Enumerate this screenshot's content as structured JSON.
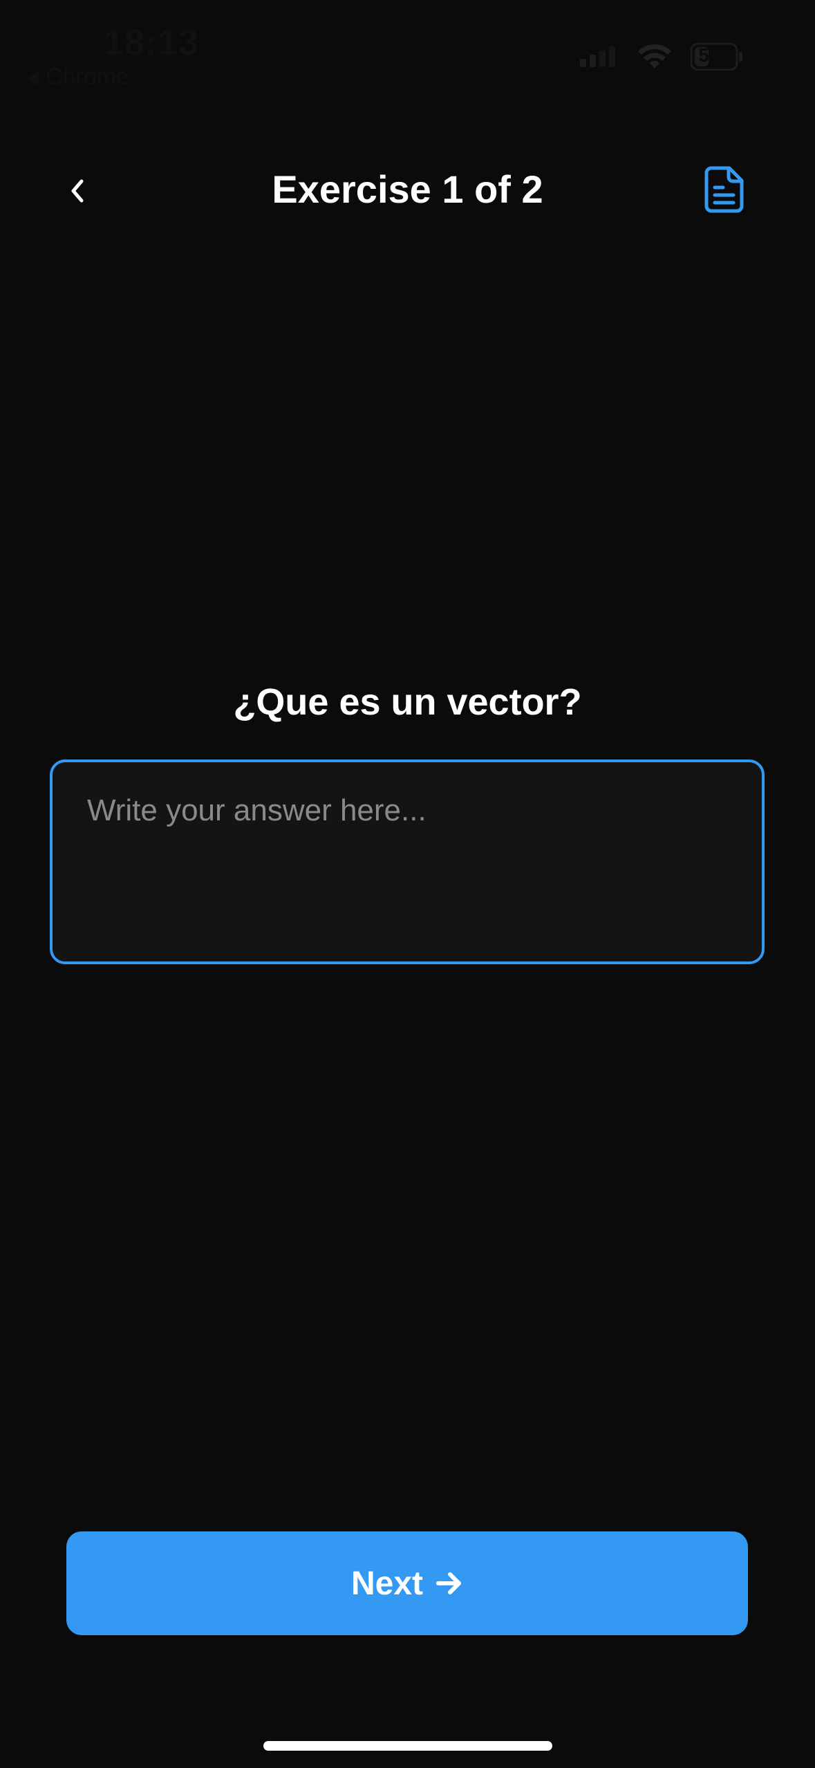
{
  "status_bar": {
    "time": "18:13",
    "back_app": "Chrome",
    "battery": "5"
  },
  "header": {
    "title": "Exercise 1 of 2",
    "back_icon": "chevron-left-icon",
    "doc_icon": "document-icon"
  },
  "question": {
    "text": "¿Que es un vector?"
  },
  "answer": {
    "placeholder": "Write your answer here...",
    "value": ""
  },
  "next_button": {
    "label": "Next",
    "icon": "arrow-right-icon"
  },
  "colors": {
    "background": "#0b0b0c",
    "accent": "#3399f3",
    "input_bg": "#141415",
    "placeholder": "#8a8a8e"
  }
}
